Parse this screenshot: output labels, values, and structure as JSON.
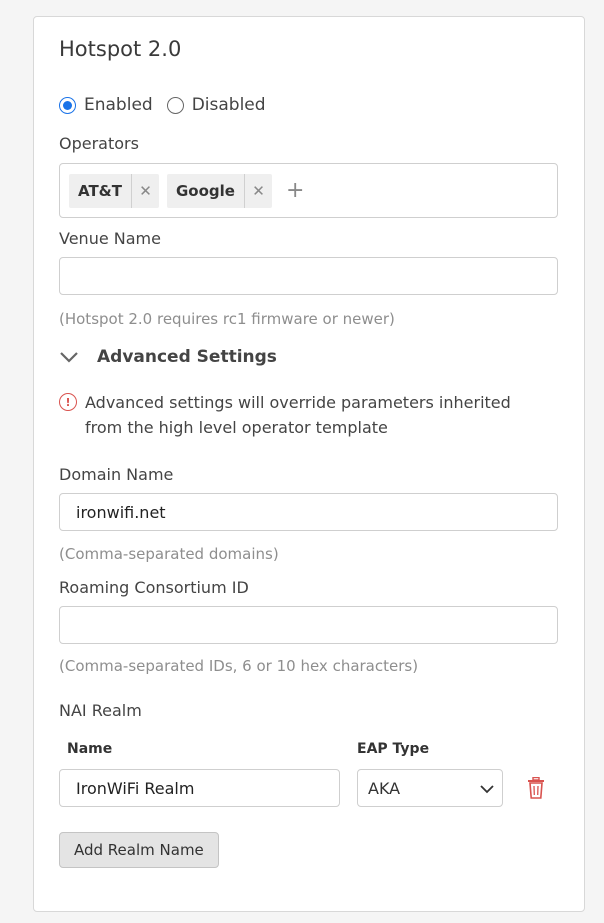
{
  "title": "Hotspot 2.0",
  "status": {
    "enabled_label": "Enabled",
    "disabled_label": "Disabled",
    "selected": "enabled"
  },
  "operators": {
    "label": "Operators",
    "tags": [
      "AT&T",
      "Google"
    ]
  },
  "venue_name": {
    "label": "Venue Name",
    "value": "",
    "hint": "(Hotspot 2.0 requires rc1 firmware or newer)"
  },
  "advanced": {
    "title": "Advanced Settings",
    "warning_line1": "Advanced settings will override parameters inherited",
    "warning_line2": "from the high level operator template"
  },
  "domain_name": {
    "label": "Domain Name",
    "value": "ironwifi.net",
    "hint": "(Comma-separated domains)"
  },
  "roaming": {
    "label": "Roaming Consortium ID",
    "value": "",
    "hint": "(Comma-separated IDs, 6 or 10 hex characters)"
  },
  "nai_realm": {
    "label": "NAI Realm",
    "col_name": "Name",
    "col_eap": "EAP Type",
    "row_name": "IronWiFi Realm",
    "row_eap": "AKA",
    "add_button": "Add Realm Name"
  },
  "colors": {
    "accent": "#1a73e8",
    "danger": "#d9534f"
  }
}
